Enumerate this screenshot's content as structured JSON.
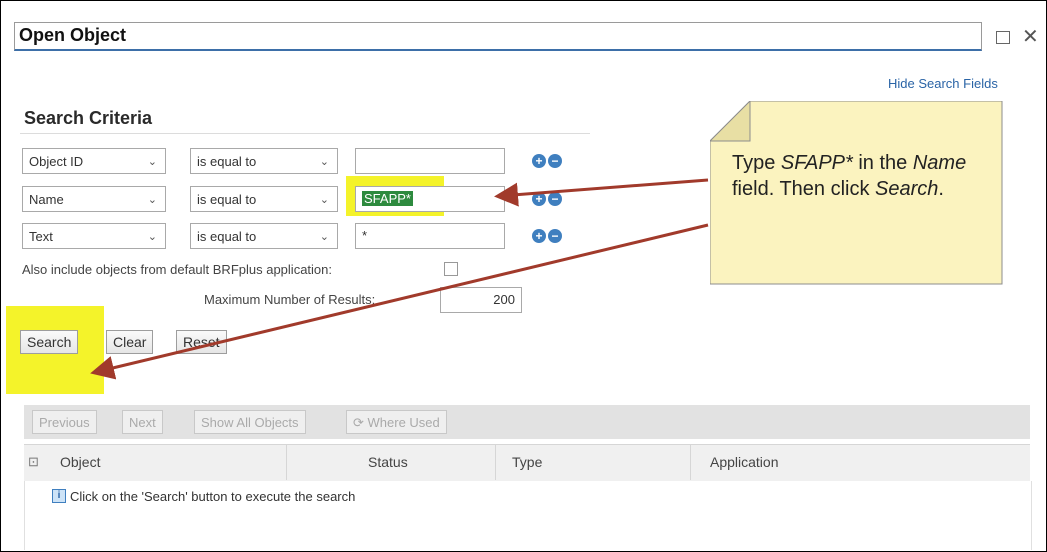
{
  "window": {
    "title": "Open Object",
    "maximize_glyph": "",
    "close_glyph": "✕"
  },
  "links": {
    "hide_search_fields": "Hide Search Fields"
  },
  "search_criteria": {
    "title": "Search Criteria",
    "rows": [
      {
        "field": "Object ID",
        "operator": "is equal to",
        "value": ""
      },
      {
        "field": "Name",
        "operator": "is equal to",
        "value": "SFAPP*"
      },
      {
        "field": "Text",
        "operator": "is equal to",
        "value": "*"
      }
    ],
    "include_default_label": "Also include objects from default BRFplus application:",
    "max_results_label": "Maximum Number of Results:",
    "max_results_value": "200"
  },
  "buttons": {
    "search": "Search",
    "clear": "Clear",
    "reset": "Reset"
  },
  "results_toolbar": {
    "previous": "Previous",
    "next": "Next",
    "show_all": "Show All Objects",
    "where_used": "Where Used"
  },
  "results_table": {
    "columns": [
      "Object",
      "Status",
      "Type",
      "Application"
    ],
    "message": "Click on the 'Search' button to execute the search"
  },
  "callout": {
    "part1": "Type ",
    "code": "SFAPP*",
    "part2": " in the ",
    "field": "Name",
    "part3": " field. Then click ",
    "action": "Search",
    "part4": "."
  },
  "colors": {
    "accent": "#3d6fa8",
    "highlight": "#f4f32a",
    "note": "#fbf3bf",
    "arrow": "#a13a2b"
  }
}
